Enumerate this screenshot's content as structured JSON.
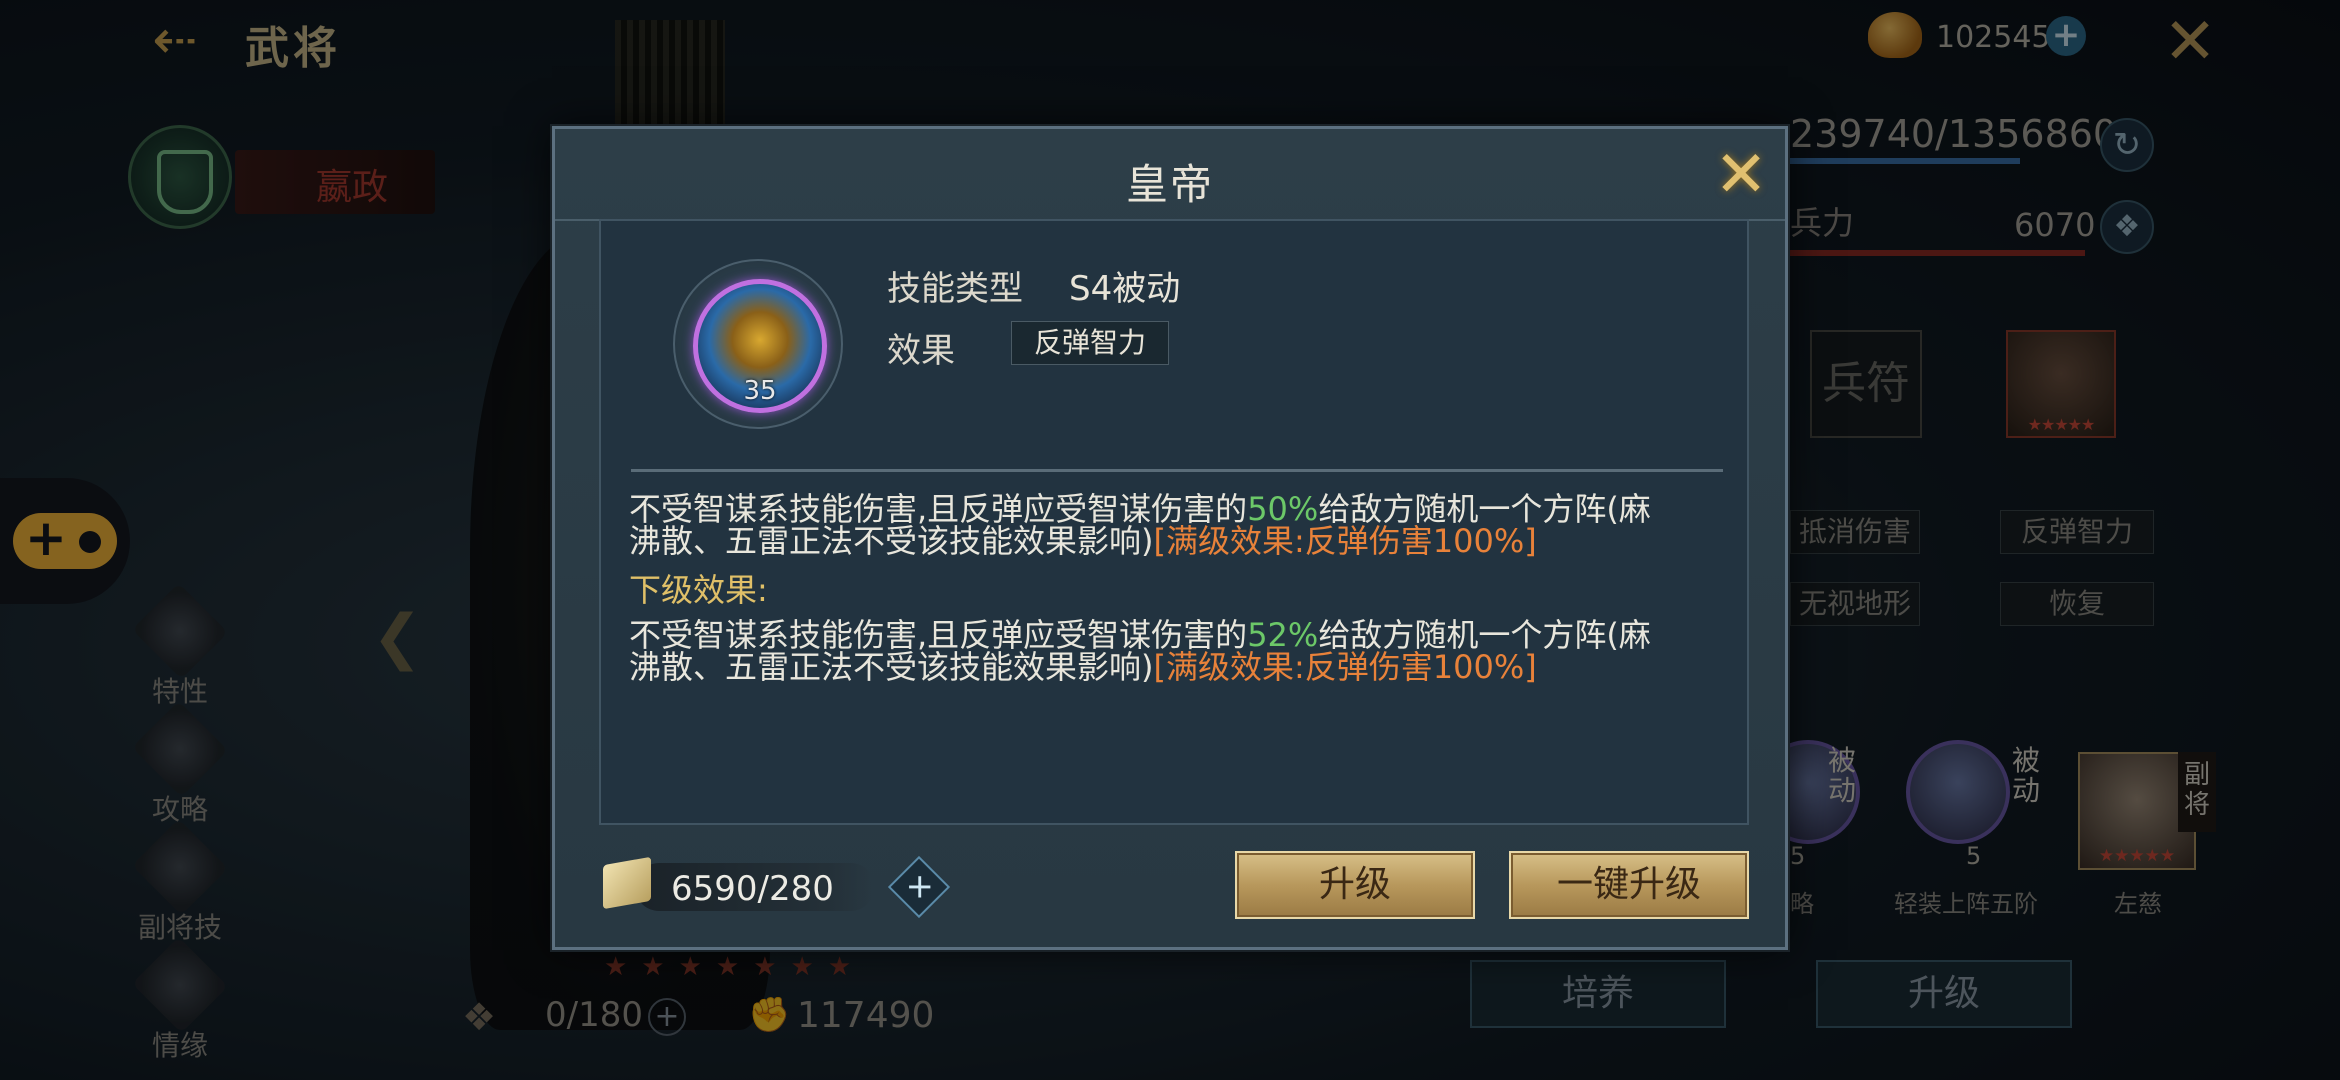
{
  "header": {
    "title": "武将",
    "currency_value": "102545"
  },
  "hero": {
    "name": "嬴政"
  },
  "side_menu": [
    {
      "label": "特性"
    },
    {
      "label": "攻略"
    },
    {
      "label": "副将技"
    },
    {
      "label": "情缘"
    }
  ],
  "stats": {
    "hp": "239740/13568600",
    "troop_label": "兵力",
    "troop_value": "6070"
  },
  "equipment": {
    "token_label": "兵符",
    "tags": [
      "抵消伤害",
      "反弹智力",
      "无视地形",
      "恢复"
    ]
  },
  "skills": [
    {
      "tag": "被动",
      "level": "5",
      "label": "略"
    },
    {
      "tag": "被动",
      "level": "5",
      "label": "轻装上阵五阶"
    }
  ],
  "deputy": {
    "tag": "副将",
    "name": "左慈"
  },
  "bottom": {
    "shards": "0/180",
    "power": "117490",
    "train_button": "培养",
    "upgrade_button": "升级"
  },
  "modal": {
    "title": "皇帝",
    "skill_level": "35",
    "skill_type_label": "技能类型",
    "skill_type_value": "S4被动",
    "effect_label": "效果",
    "effect_value": "反弹智力",
    "current": {
      "part1": "不受智谋系技能伤害,且反弹应受智谋伤害的",
      "percent": "50%",
      "part2": "给敌方随机一个方阵(麻",
      "line2": "沸散、五雷正法不受该技能效果影响)",
      "max_effect": "[满级效果:反弹伤害100%]"
    },
    "next_label": "下级效果:",
    "next": {
      "part1": "不受智谋系技能伤害,且反弹应受智谋伤害的",
      "percent": "52%",
      "part2": "给敌方随机一个方阵(麻",
      "line2": "沸散、五雷正法不受该技能效果影响)",
      "max_effect": "[满级效果:反弹伤害100%]"
    },
    "exp": "6590/280",
    "upgrade_button": "升级",
    "one_key_upgrade_button": "一键升级"
  }
}
